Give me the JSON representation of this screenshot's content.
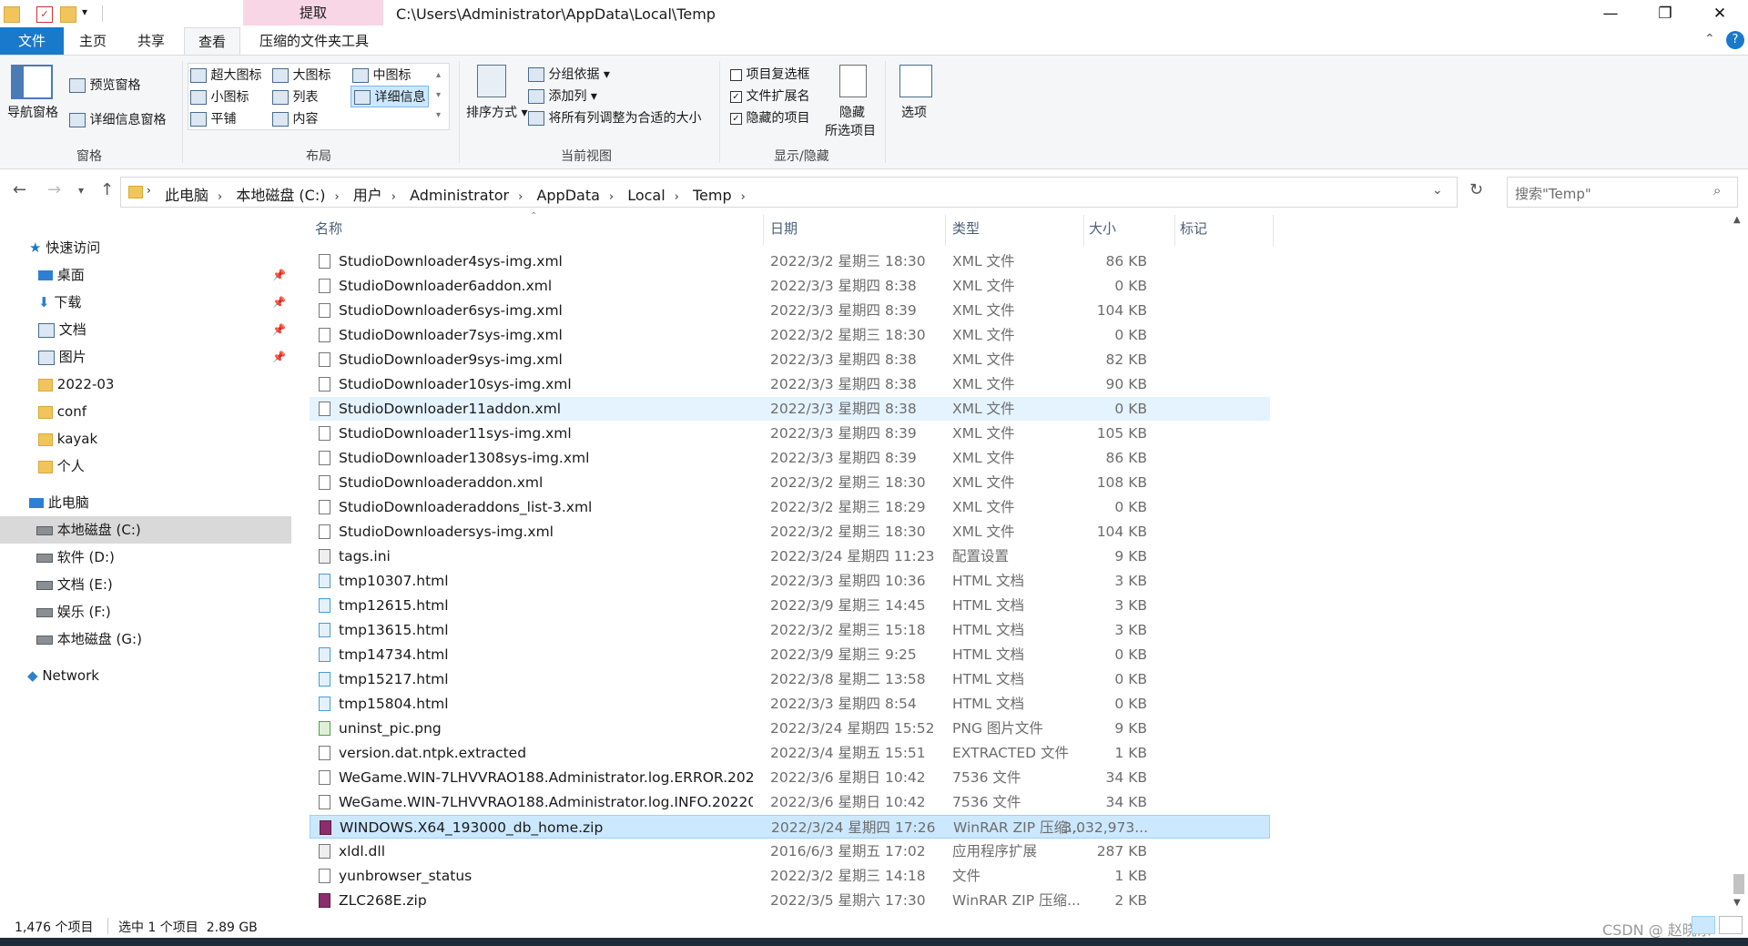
{
  "window": {
    "path_title": "C:\\Users\\Administrator\\AppData\\Local\\Temp",
    "context_tab": "提取"
  },
  "tabs": [
    "文件",
    "主页",
    "共享",
    "查看",
    "压缩的文件夹工具"
  ],
  "ribbon": {
    "panes": {
      "nav_pane": "导航窗格",
      "preview": "预览窗格",
      "details": "详细信息窗格",
      "group": "窗格"
    },
    "layout": {
      "xl_icons": "超大图标",
      "large_icons": "大图标",
      "medium_icons": "中图标",
      "small_icons": "小图标",
      "list": "列表",
      "details": "详细信息",
      "tiles": "平铺",
      "content": "内容",
      "group": "布局"
    },
    "current_view": {
      "sort_by": "排序方式",
      "group_by": "分组依据",
      "add_columns": "添加列",
      "fit_columns": "将所有列调整为合适的大小",
      "group": "当前视图"
    },
    "show_hide": {
      "item_checkboxes": "项目复选框",
      "file_extensions": "文件扩展名",
      "hidden_items": "隐藏的项目",
      "hide_selected": "隐藏",
      "hide_selected2": "所选项目",
      "group": "显示/隐藏"
    },
    "options": "选项"
  },
  "address": {
    "crumbs": [
      "此电脑",
      "本地磁盘 (C:)",
      "用户",
      "Administrator",
      "AppData",
      "Local",
      "Temp"
    ],
    "search_placeholder": "搜索\"Temp\""
  },
  "nav": {
    "quick_access": "快速访问",
    "quick_items": [
      "桌面",
      "下载",
      "文档",
      "图片",
      "2022-03",
      "conf",
      "kayak",
      "个人"
    ],
    "this_pc": "此电脑",
    "drives": [
      "本地磁盘 (C:)",
      "软件 (D:)",
      "文档 (E:)",
      "娱乐 (F:)",
      "本地磁盘 (G:)"
    ],
    "network": "Network"
  },
  "columns": {
    "name": "名称",
    "date": "日期",
    "type": "类型",
    "size": "大小",
    "tags": "标记"
  },
  "files": [
    {
      "name": "StudioDownloader4sys-img.xml",
      "date": "2022/3/2 星期三 18:30",
      "type": "XML 文件",
      "size": "86 KB"
    },
    {
      "name": "StudioDownloader6addon.xml",
      "date": "2022/3/3 星期四 8:38",
      "type": "XML 文件",
      "size": "0 KB"
    },
    {
      "name": "StudioDownloader6sys-img.xml",
      "date": "2022/3/3 星期四 8:39",
      "type": "XML 文件",
      "size": "104 KB"
    },
    {
      "name": "StudioDownloader7sys-img.xml",
      "date": "2022/3/2 星期三 18:30",
      "type": "XML 文件",
      "size": "0 KB"
    },
    {
      "name": "StudioDownloader9sys-img.xml",
      "date": "2022/3/3 星期四 8:38",
      "type": "XML 文件",
      "size": "82 KB"
    },
    {
      "name": "StudioDownloader10sys-img.xml",
      "date": "2022/3/3 星期四 8:38",
      "type": "XML 文件",
      "size": "90 KB"
    },
    {
      "name": "StudioDownloader11addon.xml",
      "date": "2022/3/3 星期四 8:38",
      "type": "XML 文件",
      "size": "0 KB"
    },
    {
      "name": "StudioDownloader11sys-img.xml",
      "date": "2022/3/3 星期四 8:39",
      "type": "XML 文件",
      "size": "105 KB"
    },
    {
      "name": "StudioDownloader1308sys-img.xml",
      "date": "2022/3/3 星期四 8:39",
      "type": "XML 文件",
      "size": "86 KB"
    },
    {
      "name": "StudioDownloaderaddon.xml",
      "date": "2022/3/2 星期三 18:30",
      "type": "XML 文件",
      "size": "108 KB"
    },
    {
      "name": "StudioDownloaderaddons_list-3.xml",
      "date": "2022/3/2 星期三 18:29",
      "type": "XML 文件",
      "size": "0 KB"
    },
    {
      "name": "StudioDownloadersys-img.xml",
      "date": "2022/3/2 星期三 18:30",
      "type": "XML 文件",
      "size": "104 KB"
    },
    {
      "name": "tags.ini",
      "date": "2022/3/24 星期四 11:23",
      "type": "配置设置",
      "size": "9 KB"
    },
    {
      "name": "tmp10307.html",
      "date": "2022/3/3 星期四 10:36",
      "type": "HTML 文档",
      "size": "3 KB"
    },
    {
      "name": "tmp12615.html",
      "date": "2022/3/9 星期三 14:45",
      "type": "HTML 文档",
      "size": "3 KB"
    },
    {
      "name": "tmp13615.html",
      "date": "2022/3/2 星期三 15:18",
      "type": "HTML 文档",
      "size": "3 KB"
    },
    {
      "name": "tmp14734.html",
      "date": "2022/3/9 星期三 9:25",
      "type": "HTML 文档",
      "size": "0 KB"
    },
    {
      "name": "tmp15217.html",
      "date": "2022/3/8 星期二 13:58",
      "type": "HTML 文档",
      "size": "0 KB"
    },
    {
      "name": "tmp15804.html",
      "date": "2022/3/3 星期四 8:54",
      "type": "HTML 文档",
      "size": "0 KB"
    },
    {
      "name": "uninst_pic.png",
      "date": "2022/3/24 星期四 15:52",
      "type": "PNG 图片文件",
      "size": "9 KB"
    },
    {
      "name": "version.dat.ntpk.extracted",
      "date": "2022/3/4 星期五 15:51",
      "type": "EXTRACTED 文件",
      "size": "1 KB"
    },
    {
      "name": "WeGame.WIN-7LHVVRAO188.Administrator.log.ERROR.2022...",
      "date": "2022/3/6 星期日 10:42",
      "type": "7536 文件",
      "size": "34 KB"
    },
    {
      "name": "WeGame.WIN-7LHVVRAO188.Administrator.log.INFO.20220...",
      "date": "2022/3/6 星期日 10:42",
      "type": "7536 文件",
      "size": "34 KB"
    },
    {
      "name": "WINDOWS.X64_193000_db_home.zip",
      "date": "2022/3/24 星期四 17:26",
      "type": "WinRAR ZIP 压缩...",
      "size": "3,032,973..."
    },
    {
      "name": "xldl.dll",
      "date": "2016/6/3 星期五 17:02",
      "type": "应用程序扩展",
      "size": "287 KB"
    },
    {
      "name": "yunbrowser_status",
      "date": "2022/3/2 星期三 14:18",
      "type": "文件",
      "size": "1 KB"
    },
    {
      "name": "ZLC268E.zip",
      "date": "2022/3/5 星期六 17:30",
      "type": "WinRAR ZIP 压缩...",
      "size": "2 KB"
    }
  ],
  "status": {
    "count": "1,476 个项目",
    "selected": "选中 1 个项目  2.89 GB"
  },
  "watermark": "CSDN @ 赵晓东",
  "colors": {
    "accent": "#1979ca",
    "selection": "#cce8ff",
    "hover": "#e5f3ff",
    "context_tab": "#f8d6e6"
  }
}
